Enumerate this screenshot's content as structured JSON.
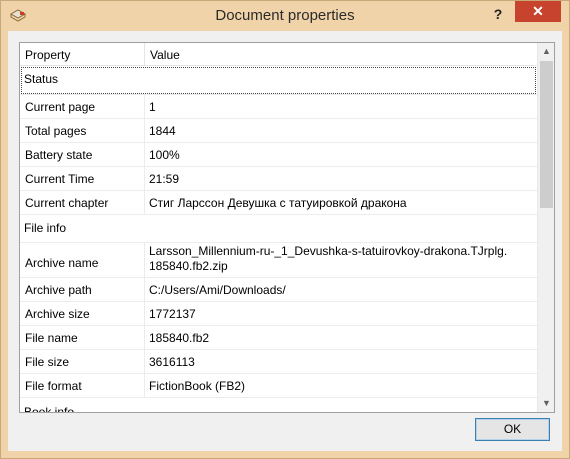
{
  "window": {
    "title": "Document properties",
    "help_label": "?",
    "close_label": "✕"
  },
  "table": {
    "headers": {
      "property": "Property",
      "value": "Value"
    },
    "rows": [
      {
        "property": "Status",
        "value": "",
        "section": true
      },
      {
        "property": "Current page",
        "value": "1"
      },
      {
        "property": "Total pages",
        "value": "1844"
      },
      {
        "property": "Battery state",
        "value": "100%"
      },
      {
        "property": "Current Time",
        "value": "21:59"
      },
      {
        "property": "Current chapter",
        "value": "Стиг Ларссон Девушка с татуировкой дракона"
      },
      {
        "property": "File info",
        "value": "",
        "section": true
      },
      {
        "property": "Archive name",
        "value": "Larsson_Millennium-ru-_1_Devushka-s-tatuirovkoy-drakona.TJrplg.\n185840.fb2.zip"
      },
      {
        "property": "Archive path",
        "value": "C:/Users/Ami/Downloads/"
      },
      {
        "property": "Archive size",
        "value": "1772137"
      },
      {
        "property": "File name",
        "value": "185840.fb2"
      },
      {
        "property": "File size",
        "value": "3616113"
      },
      {
        "property": "File format",
        "value": "FictionBook (FB2)"
      },
      {
        "property": "Book info",
        "value": "",
        "section": true
      }
    ]
  },
  "buttons": {
    "ok_label": "OK"
  },
  "scrollbar": {
    "up_icon": "chevron-up-icon",
    "down_icon": "chevron-down-icon"
  }
}
